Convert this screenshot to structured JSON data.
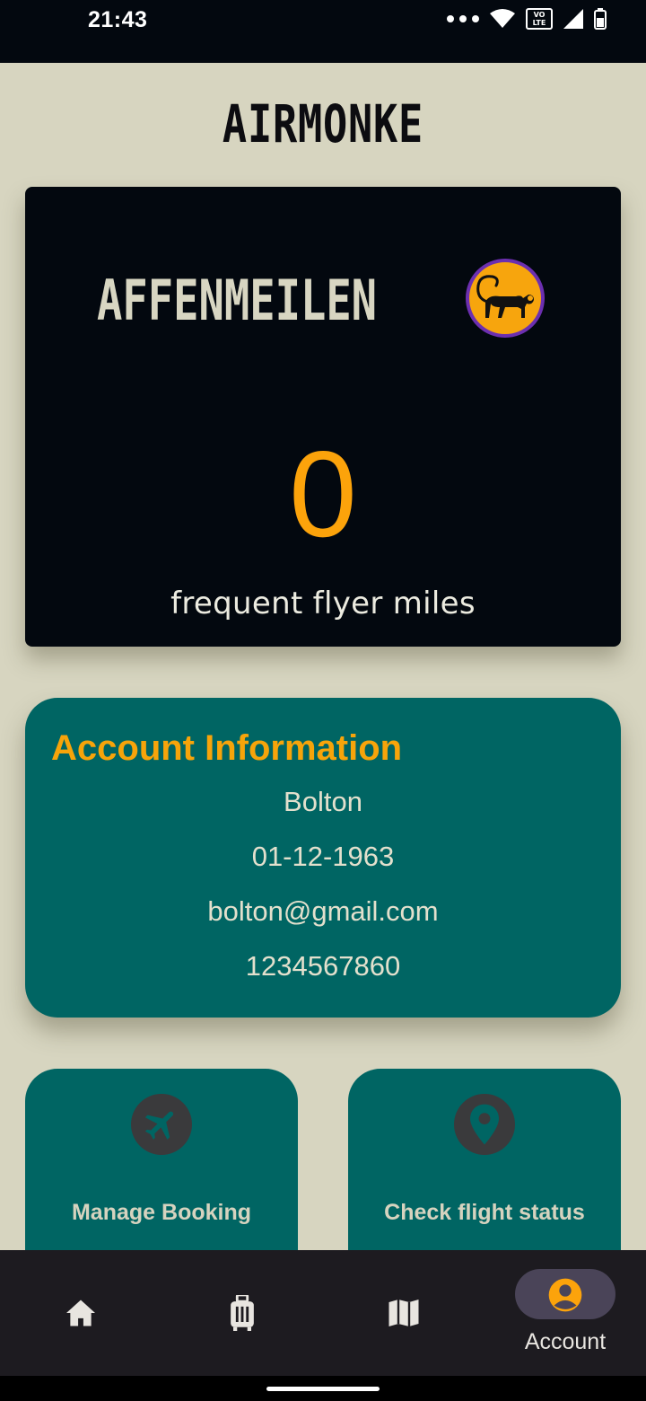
{
  "status_bar": {
    "time": "21:43",
    "icons": [
      "more-dots-icon",
      "wifi-icon",
      "volte-icon",
      "signal-icon",
      "battery-icon"
    ],
    "volte_top": "VO",
    "volte_bottom": "LTE"
  },
  "header": {
    "title": "AIRMONKE"
  },
  "miles_card": {
    "brand_text": "AFFENMEILEN",
    "logo_icon": "monkey-logo-icon",
    "miles_value": "0",
    "miles_label": "frequent flyer miles"
  },
  "account": {
    "heading": "Account Information",
    "name": "Bolton",
    "dob": "01-12-1963",
    "email": "bolton@gmail.com",
    "phone": "1234567860"
  },
  "actions": [
    {
      "label": "Manage Booking",
      "icon": "airplane-icon"
    },
    {
      "label": "Check flight status",
      "icon": "location-pin-icon"
    }
  ],
  "bottom_nav": {
    "items": [
      {
        "icon": "home-icon",
        "label": ""
      },
      {
        "icon": "luggage-icon",
        "label": ""
      },
      {
        "icon": "map-icon",
        "label": ""
      },
      {
        "icon": "account-circle-icon",
        "label": "Account",
        "active": true
      }
    ]
  },
  "colors": {
    "background": "#d7d5c0",
    "dark": "#03080f",
    "teal": "#006563",
    "accent_orange": "#fca30b",
    "nav_bg": "#1d1b20",
    "nav_pill": "#4a4458"
  }
}
